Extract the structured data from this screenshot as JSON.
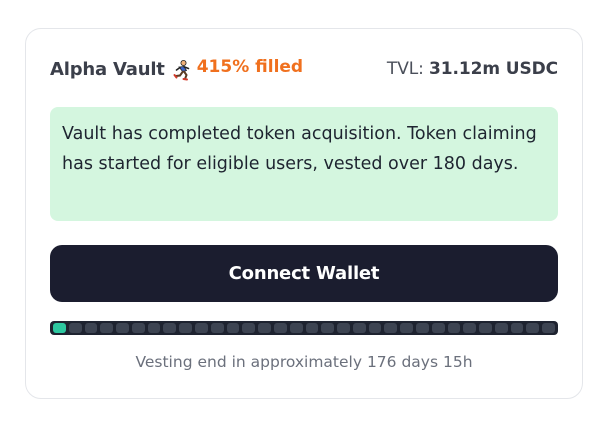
{
  "vault": {
    "name": "Alpha Vault",
    "icon": "runner-icon",
    "fill_text": "415% filled",
    "fill_color": "#f0701e"
  },
  "tvl": {
    "label": "TVL:",
    "value": "31.12m USDC"
  },
  "notice": {
    "text": "Vault has completed token acquisition. Token claiming has started for eligible users, vested over 180 days.",
    "background": "#d4f6df"
  },
  "connect_button": {
    "label": "Connect Wallet",
    "background": "#1b1d2f"
  },
  "vesting": {
    "segments_total": 32,
    "segments_filled": 1,
    "fill_color": "#2dc8a0",
    "status_text": "Vesting end in approximately 176 days 15h"
  }
}
